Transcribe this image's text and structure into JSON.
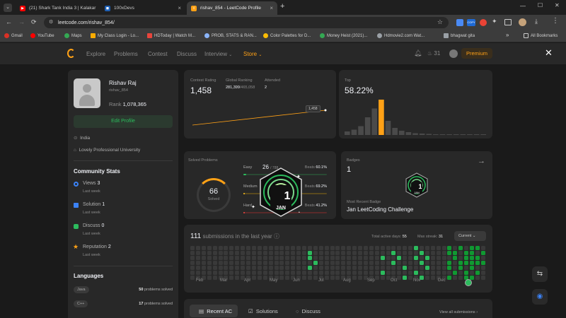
{
  "browser": {
    "tabs": [
      {
        "title": "(21) Shark Tank India 3 | Kalakar",
        "active": false
      },
      {
        "title": "100xDevs",
        "active": false
      },
      {
        "title": "rishav_854 - LeetCode Profile",
        "active": true
      }
    ],
    "new_tab": "+",
    "url": "leetcode.com/rishav_854/",
    "window_controls": {
      "minimize": "—",
      "maximize": "☐",
      "close": "✕"
    },
    "bookmarks": [
      "Gmail",
      "YouTube",
      "Maps",
      "My Class Login - Lo...",
      "HDToday | Watch M...",
      "PROB, STATS & RAN...",
      "Color Palettes for D...",
      "Money Heist (2021)...",
      "Hdmovie2.com Wat...",
      "bhagwat gita"
    ],
    "more_bookmarks": "»",
    "all_bookmarks": "All Bookmarks",
    "bookmark_colors": [
      "#d93025",
      "#ff0000",
      "#34a853",
      "#f9ab00",
      "#e8453c",
      "#8ab4f8",
      "#fbbc04",
      "#34a853",
      "#9aa0a6",
      "#9aa0a6"
    ]
  },
  "lc_nav": {
    "items": [
      "Explore",
      "Problems",
      "Contest",
      "Discuss",
      "Interview",
      "Store"
    ],
    "notification_count": "31",
    "premium": "Premium",
    "close": "✕"
  },
  "profile": {
    "name": "Rishav Raj",
    "username": "rishav_854",
    "rank_label": "Rank",
    "rank": "1,078,365",
    "edit": "Edit Profile",
    "country": "India",
    "school": "Lovely Professional University"
  },
  "community": {
    "title": "Community Stats",
    "items": [
      {
        "label": "Views",
        "value": "3",
        "sub": "Last week",
        "color": "#3b82f6"
      },
      {
        "label": "Solution",
        "value": "1",
        "sub": "Last week",
        "color": "#3b82f6"
      },
      {
        "label": "Discuss",
        "value": "0",
        "sub": "Last week",
        "color": "#2cbb5d"
      },
      {
        "label": "Reputation",
        "value": "2",
        "sub": "Last week",
        "color": "#ffa116"
      }
    ]
  },
  "languages": {
    "title": "Languages",
    "items": [
      {
        "name": "Java",
        "count": "50",
        "suffix": "problems solved"
      },
      {
        "name": "C++",
        "count": "17",
        "suffix": "problems solved"
      }
    ]
  },
  "contest": {
    "rating_label": "Contest Rating",
    "rating": "1,458",
    "global_label": "Global Ranking",
    "global": "281,399",
    "global_total": "/465,058",
    "attended_label": "Attended",
    "attended": "2",
    "tooltip": "1,458",
    "top_label": "Top",
    "top": "58.22%",
    "rating_points": [
      1443,
      1458
    ],
    "histogram_fraction": [
      0.1,
      0.15,
      0.25,
      0.5,
      0.75,
      1.0,
      0.4,
      0.2,
      0.12,
      0.08,
      0.05,
      0.04,
      0.03,
      0.02,
      0.02,
      0.02,
      0.01,
      0.01,
      0.01,
      0.01,
      0.01
    ],
    "histogram_highlight_index": 5
  },
  "solved": {
    "title": "Solved Problems",
    "total": "66",
    "total_label": "Solved",
    "rows": [
      {
        "label": "Easy",
        "count": "26",
        "of": "/ 788",
        "beats_label": "Beats",
        "beats": "60.1%",
        "fraction": 0.03,
        "color": "#2cbb5d",
        "track": "#2a4a33"
      },
      {
        "label": "Medium",
        "count": "",
        "of": "",
        "beats_label": "Beats",
        "beats": "69.2%",
        "fraction": 0.02,
        "color": "#ffc01e",
        "track": "#5a4a1e"
      },
      {
        "label": "Hard",
        "count": "",
        "of": "",
        "beats_label": "Beats",
        "beats": "41.2%",
        "fraction": 0.01,
        "color": "#ef4743",
        "track": "#5a2a2a"
      }
    ],
    "badge_overlay_month": "JAN",
    "badge_overlay_number": "1"
  },
  "badges": {
    "title": "Badges",
    "count": "1",
    "arrow": "→",
    "badge_number": "1",
    "badge_month": "JAN",
    "recent_label": "Most Recent Badge",
    "recent_name": "Jan LeetCoding Challenge"
  },
  "submissions": {
    "count": "111",
    "text": "submissions in the last year",
    "active_label": "Total active days:",
    "active": "55",
    "streak_label": "Max streak:",
    "streak": "31",
    "select": "Current",
    "months": [
      "Feb",
      "Mar",
      "Apr",
      "May",
      "Jun",
      "Jul",
      "Aug",
      "Sep",
      "Oct",
      "Nov",
      "Dec"
    ]
  },
  "bottom_tabs": {
    "items": [
      "Recent AC",
      "Solutions",
      "Discuss"
    ],
    "view_all": "View all submissions"
  }
}
